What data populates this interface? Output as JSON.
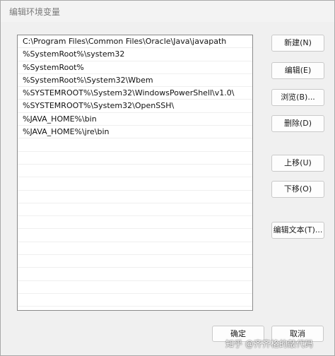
{
  "window": {
    "title": "编辑环境变量"
  },
  "path_list": {
    "items": [
      "C:\\Program Files\\Common Files\\Oracle\\Java\\javapath",
      "%SystemRoot%\\system32",
      "%SystemRoot%",
      "%SystemRoot%\\System32\\Wbem",
      "%SYSTEMROOT%\\System32\\WindowsPowerShell\\v1.0\\",
      "%SYSTEMROOT%\\System32\\OpenSSH\\",
      "%JAVA_HOME%\\bin",
      "%JAVA_HOME%\\jre\\bin",
      "",
      "",
      "",
      "",
      "",
      "",
      "",
      "",
      "",
      "",
      "",
      "",
      ""
    ]
  },
  "buttons": {
    "new": "新建(N)",
    "edit": "编辑(E)",
    "browse": "浏览(B)...",
    "delete": "删除(D)",
    "move_up": "上移(U)",
    "move_down": "下移(O)",
    "edit_text": "编辑文本(T)...",
    "ok": "确定",
    "cancel": "取消"
  },
  "watermark": {
    "text": "知乎 @齐齐格的敲代码"
  }
}
